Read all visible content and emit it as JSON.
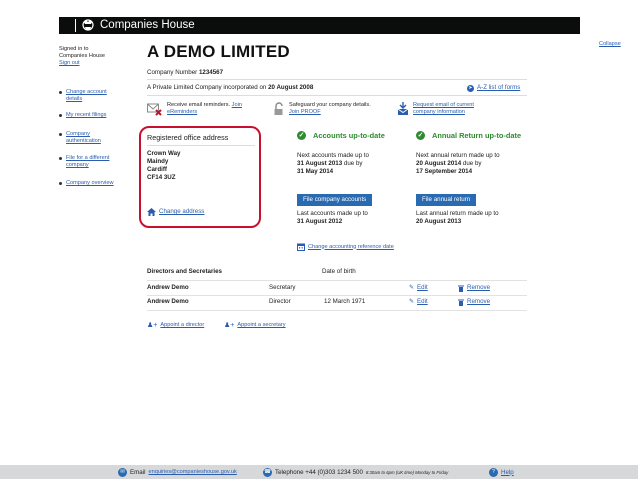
{
  "header": {
    "brand": "Companies House"
  },
  "collapse_label": "Collapse",
  "sidebar": {
    "signed_in_line1": "Signed in to",
    "signed_in_line2": "Companies House",
    "sign_out": "Sign out",
    "items": [
      {
        "line1": "Change account",
        "line2": "details"
      },
      {
        "line1": "My recent filings",
        "line2": ""
      },
      {
        "line1": "Company",
        "line2": "authentication"
      },
      {
        "line1": "File for a different",
        "line2": "company"
      },
      {
        "line1": "Company overview",
        "line2": ""
      }
    ]
  },
  "company": {
    "name": "A DEMO LIMITED",
    "number_label": "Company Number",
    "number": "1234567",
    "incorporated_text": "A Private Limited Company incorporated on",
    "incorporated_date": "20 August 2008",
    "az_link": "A-Z list of forms"
  },
  "notices": {
    "email_line1": "Receive email reminders.",
    "email_link1": "Join",
    "email_link2": "eReminders",
    "safe_line1": "Safeguard your company details.",
    "safe_link": "Join PROOF",
    "request_line1": "Request email of current",
    "request_line2": "company information"
  },
  "registered_office": {
    "heading": "Registered office address",
    "lines": [
      "Crown Way",
      "Maindy",
      "Cardiff",
      "CF14 3UZ"
    ],
    "change_link": "Change address"
  },
  "accounts": {
    "heading": "Accounts up-to-date",
    "next_label": "Next accounts made up to",
    "next_date": "31 August 2013",
    "due_by": "due by",
    "due_date": "31 May 2014",
    "button": "File company accounts",
    "last_label": "Last accounts made up to",
    "last_date": "31 August 2012",
    "change_ref_link": "Change accounting reference date"
  },
  "annual_return": {
    "heading": "Annual Return up-to-date",
    "next_label": "Next annual return made up to",
    "next_date": "20 August 2014",
    "due_by": "due by",
    "due_date": "17 September 2014",
    "button": "File annual return",
    "last_label": "Last annual return made up to",
    "last_date": "20 August 2013"
  },
  "officers": {
    "heading": "Directors and Secretaries",
    "dob_header": "Date of birth",
    "rows": [
      {
        "name": "Andrew Demo",
        "role": "Secretary",
        "dob": "",
        "edit": "Edit",
        "remove": "Remove"
      },
      {
        "name": "Andrew Demo",
        "role": "Director",
        "dob": "12 March 1971",
        "edit": "Edit",
        "remove": "Remove"
      }
    ],
    "appoint_director": "Appoint a director",
    "appoint_secretary": "Appoint a secretary"
  },
  "footer": {
    "email_label": "Email",
    "email_address": "enquiries@companieshouse.gov.uk",
    "phone_label": "Telephone +44 (0)303 1234 500",
    "phone_hours": "8:30am to 6pm (UK time) Monday to Friday",
    "help": "Help"
  },
  "colors": {
    "header_bg": "#0b0c0c",
    "link": "#2a5db0",
    "button": "#2a6ab1",
    "ok_green": "#2e8b2e",
    "highlight_red": "#c8102e"
  }
}
